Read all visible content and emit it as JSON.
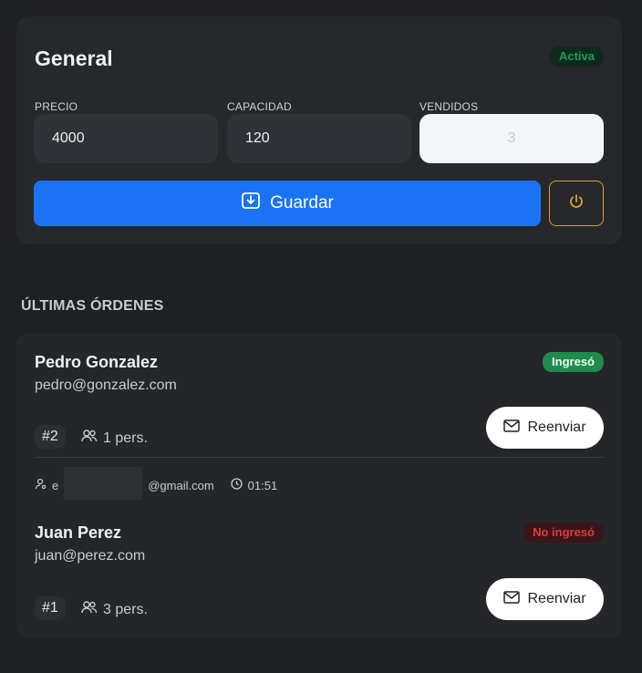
{
  "ticket": {
    "title": "General",
    "status": "Activa",
    "fields": [
      {
        "label": "PRECIO",
        "value": "4000"
      },
      {
        "label": "CAPACIDAD",
        "value": "120"
      },
      {
        "label": "VENDIDOS",
        "value": "3"
      }
    ],
    "save_label": "Guardar"
  },
  "orders_section": {
    "title": "ÚLTIMAS ÓRDENES",
    "orders": [
      {
        "name": "Pedro Gonzalez",
        "email": "pedro@gonzalez.com",
        "status": "Ingresó",
        "number": "#2",
        "persons": "1 pers.",
        "resend_label": "Reenviar",
        "meta_email_prefix": "e",
        "meta_email_suffix": "@gmail.com",
        "time": "01:51"
      },
      {
        "name": "Juan Perez",
        "email": "juan@perez.com",
        "status": "No ingresó",
        "number": "#1",
        "persons": "3 pers.",
        "resend_label": "Reenviar"
      }
    ]
  },
  "colors": {
    "primary": "#1a73f5",
    "warning": "#d9a42a",
    "success": "#1f8b4c",
    "danger": "#e03a3e"
  }
}
